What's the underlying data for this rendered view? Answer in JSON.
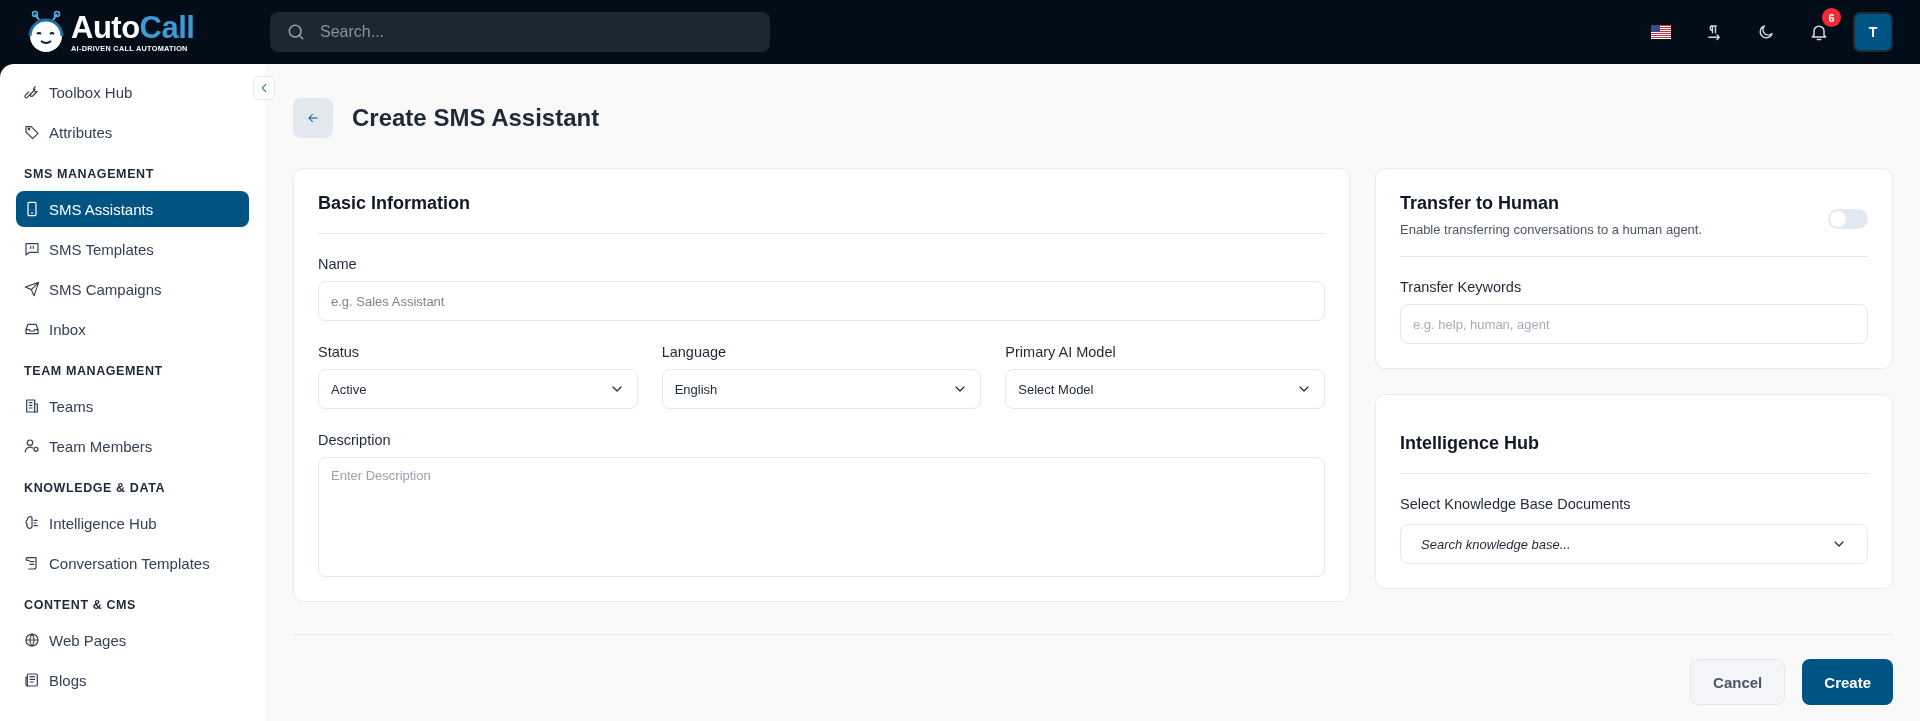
{
  "header": {
    "logo": {
      "name_part1": "Auto",
      "name_part2": "Call",
      "tagline": "AI-DRIVEN CALL AUTOMATION"
    },
    "search": {
      "placeholder": "Search..."
    },
    "notifications": {
      "count": "6"
    },
    "avatar": {
      "initial": "T"
    }
  },
  "sidebar": {
    "items": [
      {
        "kind": "link",
        "label": "Toolbox Hub",
        "selected": false
      },
      {
        "kind": "link",
        "label": "Attributes",
        "selected": false
      },
      {
        "kind": "section",
        "label": "SMS MANAGEMENT"
      },
      {
        "kind": "link",
        "label": "SMS Assistants",
        "selected": true
      },
      {
        "kind": "link",
        "label": "SMS Templates",
        "selected": false
      },
      {
        "kind": "link",
        "label": "SMS Campaigns",
        "selected": false
      },
      {
        "kind": "link",
        "label": "Inbox",
        "selected": false
      },
      {
        "kind": "section",
        "label": "TEAM MANAGEMENT"
      },
      {
        "kind": "link",
        "label": "Teams",
        "selected": false
      },
      {
        "kind": "link",
        "label": "Team Members",
        "selected": false
      },
      {
        "kind": "section",
        "label": "KNOWLEDGE & DATA"
      },
      {
        "kind": "link",
        "label": "Intelligence Hub",
        "selected": false
      },
      {
        "kind": "link",
        "label": "Conversation Templates",
        "selected": false
      },
      {
        "kind": "section",
        "label": "CONTENT & CMS"
      },
      {
        "kind": "link",
        "label": "Web Pages",
        "selected": false
      },
      {
        "kind": "link",
        "label": "Blogs",
        "selected": false
      }
    ]
  },
  "page": {
    "title": "Create SMS Assistant"
  },
  "basic_information": {
    "title": "Basic Information",
    "name": {
      "label": "Name",
      "placeholder": "e.g. Sales Assistant"
    },
    "selects": [
      {
        "label": "Status",
        "value": "Active"
      },
      {
        "label": "Language",
        "value": "English"
      },
      {
        "label": "Primary AI Model",
        "value": "Select Model"
      }
    ],
    "description": {
      "label": "Description",
      "placeholder": "Enter Description"
    }
  },
  "transfer_to_human": {
    "title": "Transfer to Human",
    "subtitle": "Enable transferring conversations to a human agent.",
    "on": false,
    "keywords": {
      "label": "Transfer Keywords",
      "placeholder": "e.g. help, human, agent"
    }
  },
  "intelligence_hub": {
    "title": "Intelligence Hub",
    "documents": {
      "label": "Select Knowledge Base Documents",
      "placeholder": "Search knowledge base..."
    }
  },
  "buttons": {
    "cancel": "Cancel",
    "create": "Create"
  }
}
